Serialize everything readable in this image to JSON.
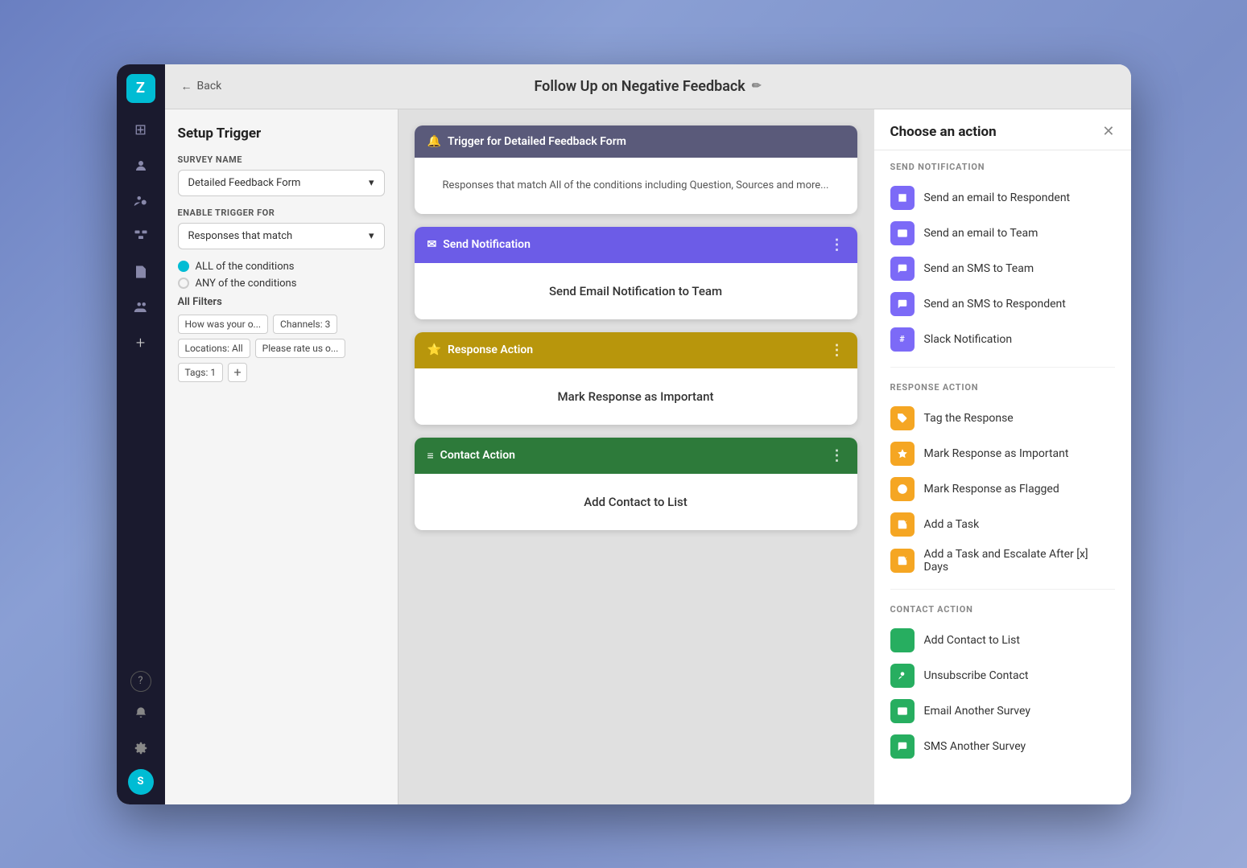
{
  "window": {
    "title": "Follow Up on Negative Feedback",
    "back_label": "Back",
    "edit_icon": "✏"
  },
  "sidebar": {
    "logo": "Z",
    "avatar": "S",
    "icons": [
      {
        "name": "grid-icon",
        "symbol": "⊞"
      },
      {
        "name": "contact-icon",
        "symbol": "👤"
      },
      {
        "name": "user-icon",
        "symbol": "👥"
      },
      {
        "name": "settings-icon",
        "symbol": "⚙"
      },
      {
        "name": "document-icon",
        "symbol": "📄"
      },
      {
        "name": "team-icon",
        "symbol": "👥"
      },
      {
        "name": "add-icon",
        "symbol": "+"
      }
    ],
    "bottom_icons": [
      {
        "name": "help-icon",
        "symbol": "?"
      },
      {
        "name": "bell-icon",
        "symbol": "🔔"
      },
      {
        "name": "gear-icon",
        "symbol": "⚙"
      }
    ]
  },
  "left_panel": {
    "title": "Setup Trigger",
    "survey_name_label": "SURVEY NAME",
    "survey_name_value": "Detailed Feedback Form",
    "enable_trigger_label": "ENABLE TRIGGER FOR",
    "enable_trigger_value": "Responses that match",
    "condition_all": "ALL of the conditions",
    "condition_any": "ANY of the conditions",
    "filters_label": "All Filters",
    "filters": [
      "How was your o...",
      "Channels: 3",
      "Locations: All",
      "Please rate us o...",
      "Tags: 1"
    ]
  },
  "flow_blocks": [
    {
      "type": "trigger",
      "header_label": "Trigger for Detailed Feedback Form",
      "header_color": "trigger",
      "icon": "🔔",
      "body_text": "Responses that match All of the conditions including Question, Sources and more...",
      "has_menu": false
    },
    {
      "type": "notification",
      "header_label": "Send Notification",
      "header_color": "notification",
      "icon": "✉",
      "body_text": "Send Email Notification to Team",
      "has_menu": true
    },
    {
      "type": "response",
      "header_label": "Response Action",
      "header_color": "response",
      "icon": "⭐",
      "body_text": "Mark Response as Important",
      "has_menu": true
    },
    {
      "type": "contact",
      "header_label": "Contact Action",
      "header_color": "contact",
      "icon": "≡",
      "body_text": "Add Contact to List",
      "has_menu": true
    }
  ],
  "right_panel": {
    "title": "Choose an action",
    "sections": [
      {
        "title": "SEND NOTIFICATION",
        "items": [
          {
            "label": "Send an email to Respondent",
            "icon": "✉",
            "icon_style": "purple"
          },
          {
            "label": "Send an email to Team",
            "icon": "✉",
            "icon_style": "purple"
          },
          {
            "label": "Send an SMS to Team",
            "icon": "💬",
            "icon_style": "purple"
          },
          {
            "label": "Send an SMS to Respondent",
            "icon": "💬",
            "icon_style": "purple"
          },
          {
            "label": "Slack Notification",
            "icon": "#",
            "icon_style": "purple"
          }
        ]
      },
      {
        "title": "RESPONSE ACTION",
        "items": [
          {
            "label": "Tag the Response",
            "icon": "🏷",
            "icon_style": "orange"
          },
          {
            "label": "Mark Response as Important",
            "icon": "⭐",
            "icon_style": "orange"
          },
          {
            "label": "Mark Response as Flagged",
            "icon": "🚩",
            "icon_style": "orange"
          },
          {
            "label": "Add a Task",
            "icon": "📋",
            "icon_style": "orange"
          },
          {
            "label": "Add a Task and Escalate After [x] Days",
            "icon": "📋",
            "icon_style": "orange"
          }
        ]
      },
      {
        "title": "CONTACT ACTION",
        "items": [
          {
            "label": "Add Contact to List",
            "icon": "≡",
            "icon_style": "green"
          },
          {
            "label": "Unsubscribe Contact",
            "icon": "👤",
            "icon_style": "green"
          },
          {
            "label": "Email Another Survey",
            "icon": "✉",
            "icon_style": "green"
          },
          {
            "label": "SMS Another Survey",
            "icon": "💬",
            "icon_style": "green"
          }
        ]
      }
    ]
  }
}
